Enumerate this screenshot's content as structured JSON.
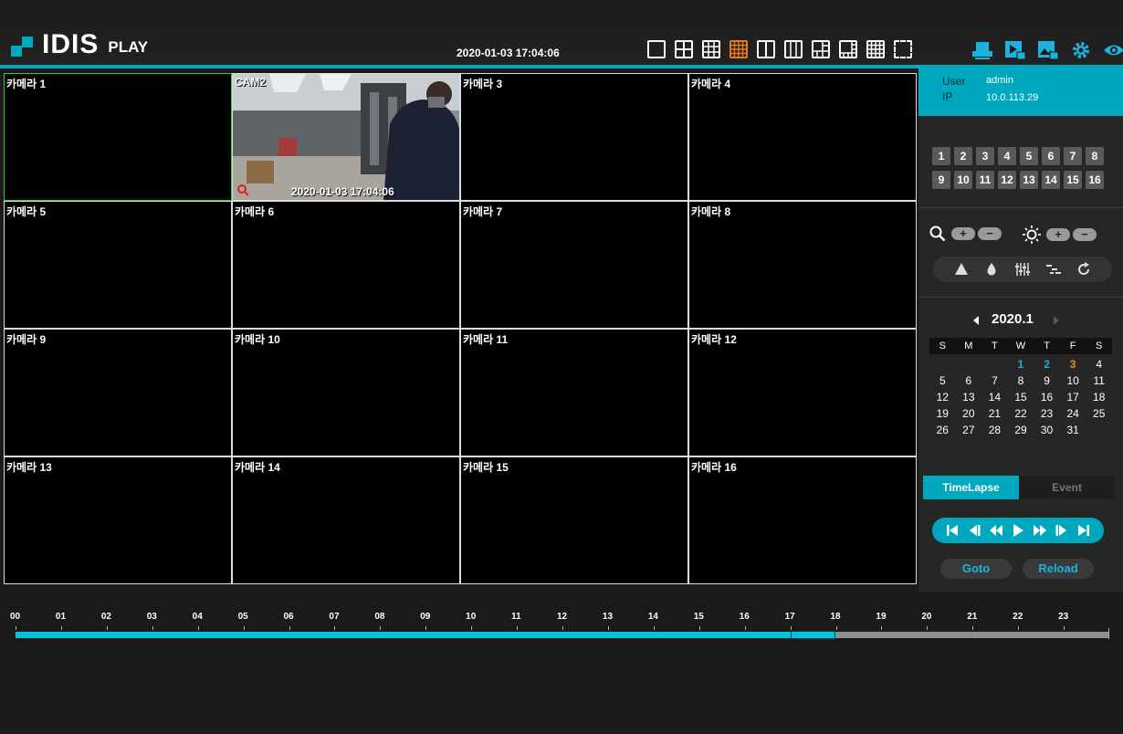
{
  "header": {
    "logo": "IDIS",
    "logo_sub": "PLAY",
    "datetime": "2020-01-03 17:04:06",
    "accent_color": "#00a8bf",
    "active_layout_color": "#e87722",
    "layouts": [
      "single",
      "quad",
      "grid-9",
      "grid-16",
      "split-2",
      "split-3",
      "layout-1-plus-5",
      "layout-1-plus-7",
      "grid-16-alt",
      "fullscreen"
    ],
    "active_layout": "grid-16",
    "icons": [
      "export-icon",
      "video-export-icon",
      "image-export-icon",
      "settings-icon",
      "view-icon"
    ]
  },
  "grid": {
    "cells": [
      {
        "label": "카메라 1",
        "selected": true
      },
      {
        "label": "CAM2",
        "has_video": true,
        "timestamp": "2020-01-03 17:04:06"
      },
      {
        "label": "카메라 3"
      },
      {
        "label": "카메라 4"
      },
      {
        "label": "카메라 5"
      },
      {
        "label": "카메라 6"
      },
      {
        "label": "카메라 7"
      },
      {
        "label": "카메라 8"
      },
      {
        "label": "카메라 9"
      },
      {
        "label": "카메라 10"
      },
      {
        "label": "카메라 11"
      },
      {
        "label": "카메라 12"
      },
      {
        "label": "카메라 13"
      },
      {
        "label": "카메라 14"
      },
      {
        "label": "카메라 15"
      },
      {
        "label": "카메라 16"
      }
    ]
  },
  "panel": {
    "user_label": "User",
    "user_value": "admin",
    "ip_label": "IP",
    "ip_value": "10.0.113.29",
    "camera_buttons": [
      "1",
      "2",
      "3",
      "4",
      "5",
      "6",
      "7",
      "8",
      "9",
      "10",
      "11",
      "12",
      "13",
      "14",
      "15",
      "16"
    ],
    "zoom_plus": "+",
    "zoom_minus": "−",
    "bright_plus": "+",
    "bright_minus": "−",
    "calendar": {
      "title": "2020.1",
      "day_names": [
        "S",
        "M",
        "T",
        "W",
        "T",
        "F",
        "S"
      ],
      "leading_blanks": 3,
      "days_in_month": 31,
      "recorded_days": [
        1,
        2
      ],
      "today": 3
    },
    "tabs": [
      "TimeLapse",
      "Event"
    ],
    "active_tab": "TimeLapse",
    "goto_label": "Goto",
    "reload_label": "Reload"
  },
  "timeline": {
    "hours": [
      "00",
      "01",
      "02",
      "03",
      "04",
      "05",
      "06",
      "07",
      "08",
      "09",
      "10",
      "11",
      "12",
      "13",
      "14",
      "15",
      "16",
      "17",
      "18",
      "19",
      "20",
      "21",
      "22",
      "23"
    ],
    "recorded_until_hour": 18,
    "cursor_hour": 17
  }
}
